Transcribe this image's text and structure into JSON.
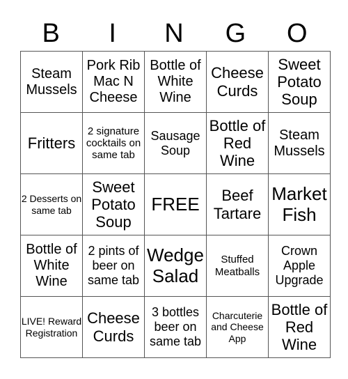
{
  "header": {
    "letters": [
      "B",
      "I",
      "N",
      "G",
      "O"
    ]
  },
  "grid": {
    "rows": [
      [
        "Steam Mussels",
        "Pork Rib Mac N Cheese",
        "Bottle of White Wine",
        "Cheese Curds",
        "Sweet Potato Soup"
      ],
      [
        "Fritters",
        "2 signature cocktails on same tab",
        "Sausage Soup",
        "Bottle of Red Wine",
        "Steam Mussels"
      ],
      [
        "2 Desserts on same tab",
        "Sweet Potato Soup",
        "FREE",
        "Beef Tartare",
        "Market Fish"
      ],
      [
        "Bottle of White Wine",
        "2 pints of beer on same tab",
        "Wedge Salad",
        "Stuffed Meatballs",
        "Crown Apple Upgrade"
      ],
      [
        "LIVE! Reward Registration",
        "Cheese Curds",
        "3 bottles beer on same tab",
        "Charcuterie and Cheese App",
        "Bottle of Red Wine"
      ]
    ]
  }
}
